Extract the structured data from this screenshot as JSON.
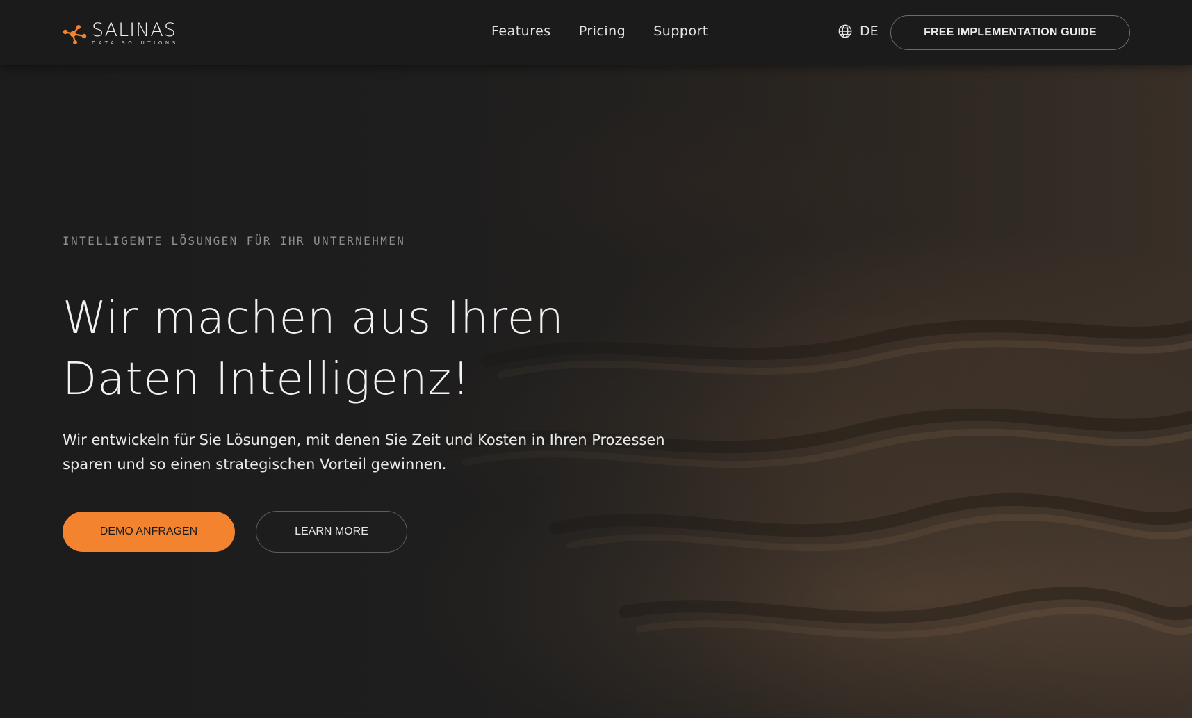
{
  "brand": {
    "name": "SALINAS",
    "tagline": "DATA SOLUTIONS",
    "accent_color": "#f3832f",
    "logo_icon": "network-nodes-icon"
  },
  "nav": {
    "items": [
      {
        "label": "Features"
      },
      {
        "label": "Pricing"
      },
      {
        "label": "Support"
      }
    ]
  },
  "language": {
    "icon": "globe-icon",
    "current": "DE"
  },
  "header_cta": {
    "label": "FREE IMPLEMENTATION GUIDE"
  },
  "hero": {
    "eyebrow": "INTELLIGENTE LÖSUNGEN FÜR IHR UNTERNEHMEN",
    "headline_line1": "Wir machen aus Ihren",
    "headline_line2": "Daten Intelligenz!",
    "description": "Wir entwickeln für Sie Lösungen, mit denen Sie Zeit und Kosten in Ihren Prozessen sparen und so einen strategischen Vorteil gewinnen.",
    "primary_button": "DEMO ANFRAGEN",
    "secondary_button": "LEARN MORE"
  }
}
